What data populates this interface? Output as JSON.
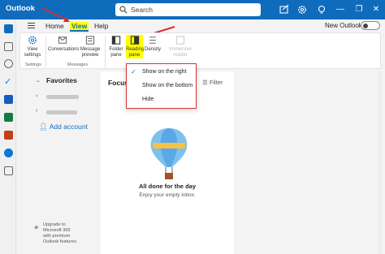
{
  "titlebar": {
    "app_title": "Outlook",
    "search_placeholder": "Search",
    "brand_color": "#0f6cbd",
    "icons": [
      "compose-icon",
      "calendar-check-icon",
      "settings-icon",
      "lightbulb-icon"
    ],
    "window_buttons": [
      "—",
      "❐",
      "✕"
    ]
  },
  "tabs": {
    "home": "Home",
    "view": "View",
    "help": "Help",
    "new_outlook_label": "New Outlook"
  },
  "ribbon": {
    "view_settings": "View\nsettings",
    "settings_group": "Settings",
    "conversations": "Conversations",
    "message_preview": "Message\npreview",
    "messages_group": "Messages",
    "folder_pane": "Folder\npane",
    "reading_pane": "Reading\npane",
    "density": "Density",
    "immersive_reader": "Immersive\nreader"
  },
  "reading_pane_menu": {
    "items": [
      "Show on the right",
      "Show on the bottom",
      "Hide"
    ],
    "selected": "Show on the right"
  },
  "folders": {
    "favorites": "Favorites",
    "add_account": "Add account",
    "upgrade_text": "Upgrade to\nMicrosoft 365\nwith premium\nOutlook features"
  },
  "message_list": {
    "focused_tab": "Focus",
    "filter": "Filter",
    "empty_title": "All done for the day",
    "empty_subtitle": "Enjoy your empty inbox."
  }
}
